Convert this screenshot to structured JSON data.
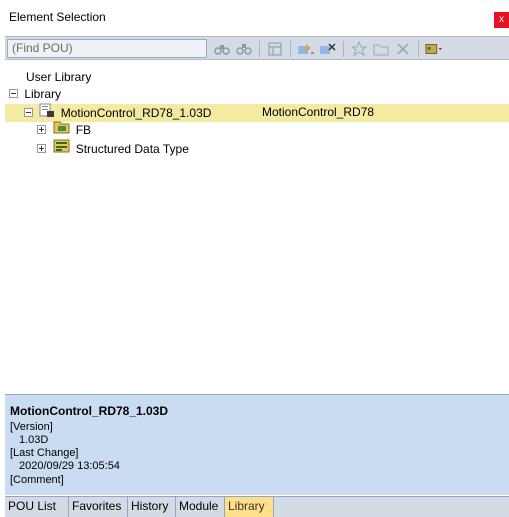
{
  "window": {
    "title": "Element Selection",
    "close_glyph": "x"
  },
  "toolbar": {
    "search_placeholder": "(Find POU)",
    "icons": [
      "find-icon",
      "find-next-icon",
      "tree-view-icon",
      "add-icon",
      "remove-icon",
      "favorite-icon",
      "folder-icon",
      "delete-icon",
      "display-options-icon"
    ]
  },
  "tree": {
    "user_library": "User Library",
    "library": "Library",
    "library_item": {
      "name": "MotionControl_RD78_1.03D",
      "title": "MotionControl_RD78"
    },
    "children": [
      {
        "label": "FB"
      },
      {
        "label": "Structured Data Type"
      }
    ]
  },
  "info": {
    "name": "MotionControl_RD78_1.03D",
    "version_label": "[Version]",
    "version": "1.03D",
    "last_change_label": "[Last Change]",
    "last_change": "2020/09/29 13:05:54",
    "comment_label": "[Comment]"
  },
  "tabs": [
    {
      "label": "POU List"
    },
    {
      "label": "Favorites"
    },
    {
      "label": "History"
    },
    {
      "label": "Module"
    },
    {
      "label": "Library",
      "active": true
    }
  ],
  "colors": {
    "selection": "#f5eaa2",
    "info_panel": "#c9dcf2",
    "active_tab": "#ffe08a",
    "close": "#e81123"
  }
}
